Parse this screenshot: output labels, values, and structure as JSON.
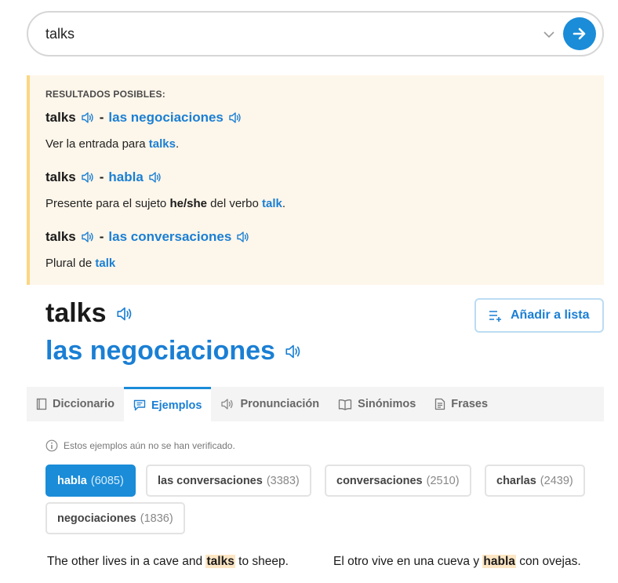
{
  "search": {
    "value": "talks"
  },
  "results": {
    "heading": "RESULTADOS POSIBLES:",
    "entries": [
      {
        "en": "talks",
        "dash": "-",
        "es": "las negociaciones",
        "desc": {
          "pre": "Ver la entrada para ",
          "link": "talks",
          "post": "."
        }
      },
      {
        "en": "talks",
        "dash": "-",
        "es": "habla",
        "desc": {
          "pre": "Presente para el sujeto ",
          "bold": "he/she",
          "mid": " del verbo ",
          "link": "talk",
          "post": "."
        }
      },
      {
        "en": "talks",
        "dash": "-",
        "es": "las conversaciones",
        "desc": {
          "pre": "Plural de ",
          "link": "talk"
        }
      }
    ]
  },
  "headword": {
    "en": "talks",
    "es": "las negociaciones"
  },
  "add_list_label": "Añadir a lista",
  "tabs": [
    {
      "label": "Diccionario",
      "icon": "book-icon"
    },
    {
      "label": "Ejemplos",
      "icon": "speech-bubble-icon"
    },
    {
      "label": "Pronunciación",
      "icon": "speaker-icon"
    },
    {
      "label": "Sinónimos",
      "icon": "open-book-icon"
    },
    {
      "label": "Frases",
      "icon": "document-icon"
    }
  ],
  "notice": "Estos ejemplos aún no se han verificado.",
  "chips": [
    {
      "label": "habla",
      "count": "(6085)"
    },
    {
      "label": "las conversaciones",
      "count": "(3383)"
    },
    {
      "label": "conversaciones",
      "count": "(2510)"
    },
    {
      "label": "charlas",
      "count": "(2439)"
    },
    {
      "label": "negociaciones",
      "count": "(1836)"
    }
  ],
  "example": {
    "en": {
      "pre": "The other lives in a cave and ",
      "hl": "talks",
      "post": " to sheep."
    },
    "es": {
      "pre": "El otro vive en una cueva y ",
      "hl": "habla",
      "post": " con ovejas."
    }
  },
  "colors": {
    "accent": "#1a8cd8",
    "link": "#1a7fd4",
    "results_bg": "#fdf6ea",
    "results_border": "#fbd682",
    "highlight": "#fde6c4"
  }
}
